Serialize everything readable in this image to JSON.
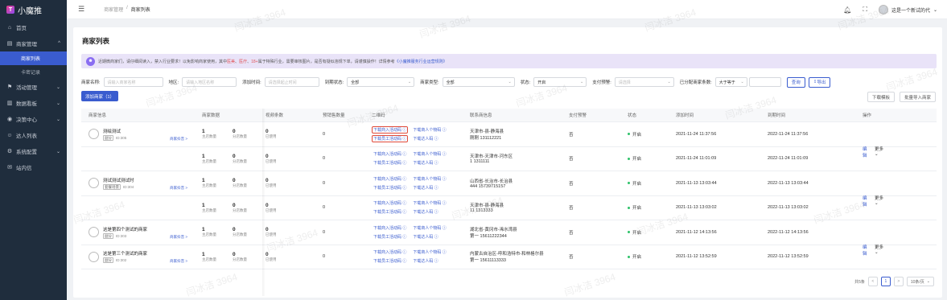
{
  "app": {
    "logo_mark": "T",
    "name": "小魔推"
  },
  "sidebar": {
    "items": [
      {
        "icon": "⌂",
        "label": "首页"
      },
      {
        "icon": "▤",
        "label": "商家管理",
        "chev": "^",
        "open": true
      },
      {
        "icon": "⚑",
        "label": "活动管理",
        "chev": "⌄"
      },
      {
        "icon": "▥",
        "label": "数据看板",
        "chev": "⌄"
      },
      {
        "icon": "◉",
        "label": "决策中心",
        "chev": "⌄"
      },
      {
        "icon": "☺",
        "label": "达人列表"
      },
      {
        "icon": "⚙",
        "label": "系统配置",
        "chev": "⌄"
      },
      {
        "icon": "✉",
        "label": "站内信"
      }
    ],
    "subitems": [
      {
        "label": "商家列表",
        "active": true
      },
      {
        "label": "卡密记录",
        "active": false
      }
    ]
  },
  "header": {
    "breadcrumb": [
      "商家管理",
      "商家列表"
    ],
    "user": "这是一个新试的代",
    "icons": [
      "bell-icon",
      "fullscreen-icon"
    ]
  },
  "page": {
    "title": "商家列表"
  },
  "notice": {
    "pre": "近期微商家们，请仔细阅读入，禁入行业要求！以免影响商家使用，其中",
    "red1": "医美",
    "mid1": "、",
    "red2": "医疗",
    "mid2": "、",
    "red3": "18+",
    "mid3": "属于特殊行业，需要审核图片，是否有疑似违规下单，请谨慎操作！详情参考",
    "link": "《小魔推服务行业运营规则》"
  },
  "filters": {
    "shop_name": {
      "label": "商家名称:",
      "placeholder": "请输入商家名称"
    },
    "region": {
      "label": "地区:",
      "placeholder": "请输入地区名称"
    },
    "add_time": {
      "label": "添加时间:",
      "placeholder": "请选择起止时间"
    },
    "expire_status": {
      "label": "到期状态:",
      "value": "全部"
    },
    "shop_type": {
      "label": "商家类型:",
      "value": "全部"
    },
    "status": {
      "label": "状态:",
      "value": "开启"
    },
    "pay_warn": {
      "label": "支付预警:",
      "placeholder": "请选择"
    },
    "dist_count": {
      "label": "已分配商家条数:",
      "op": "大于等于",
      "value": ""
    },
    "search_label": "查询",
    "export_label": "导出"
  },
  "actions": {
    "add": "添加商家（1）",
    "download_tpl": "下载模板",
    "batch_import": "批量导入商家"
  },
  "table": {
    "headers": [
      "商家信息",
      "商家数据",
      "视频条数",
      "预销售数量",
      "二维码",
      "联系商信息",
      "支付预警",
      "状态",
      "添加时间",
      "到期时间",
      "操作"
    ],
    "data_labels": [
      "主店数量",
      "分店数量"
    ],
    "tpl_label": "已使用",
    "qr_labels": {
      "shop_qr": "下载商入活动码",
      "person_qr": "下载商人个物码",
      "staff_qr": "下载员工活动码",
      "entry_qr": "下载达人码"
    },
    "op_labels": {
      "edit": "编辑",
      "more": "更多"
    },
    "shop_link": "商家抖音",
    "rows": [
      {
        "name": "测绘测试",
        "tag": "副分",
        "id": "ID:305",
        "main": "1",
        "branch": "0",
        "tpl": "0",
        "recv": "0",
        "region": "天津市-县-静海县",
        "phone": "刚刚 131112221",
        "pay": "否",
        "status": "开启",
        "added": "2021-11-24 11:37:56",
        "expire": "2022-11-24 11:37:56"
      },
      {
        "name": "",
        "tag": "",
        "id": "",
        "main": "1",
        "branch": "0",
        "tpl": "0",
        "recv": "0",
        "region": "天津市-天津市-河东区",
        "phone": "1  1311111",
        "pay": "否",
        "status": "开启",
        "added": "2021-11-24 11:01:09",
        "expire": "2022-11-24 11:01:09"
      },
      {
        "name": "测试测试测试时",
        "tag": "套餐场景",
        "id": "ID:304",
        "main": "1",
        "branch": "0",
        "tpl": "0",
        "recv": "0",
        "region": "山西省-长治市-长治县",
        "phone": "444  15739715157",
        "pay": "否",
        "status": "开启",
        "added": "2021-11-13 13:03:44",
        "expire": "2022-11-13 13:03:44"
      },
      {
        "name": "",
        "tag": "",
        "id": "",
        "main": "1",
        "branch": "0",
        "tpl": "0",
        "recv": "0",
        "region": "天津市-县-静海县",
        "phone": "11  1313333",
        "pay": "否",
        "status": "开启",
        "added": "2021-11-13 13:03:02",
        "expire": "2022-11-13 13:03:02"
      },
      {
        "name": "这是第四个测试的商家",
        "tag": "副分",
        "id": "ID:303",
        "main": "1",
        "branch": "0",
        "tpl": "0",
        "recv": "0",
        "region": "湖北省-黄冈市-浠水湾县",
        "phone": "第一  15611222344",
        "pay": "否",
        "status": "开启",
        "added": "2021-11-12 14:13:56",
        "expire": "2022-11-12 14:13:56"
      },
      {
        "name": "这是第三个测试的商家",
        "tag": "副分",
        "id": "ID:302",
        "main": "1",
        "branch": "0",
        "tpl": "0",
        "recv": "0",
        "region": "内蒙古自治区-呼和浩特市-和林格尔县",
        "phone": "第一  15611113333",
        "pay": "否",
        "status": "开启",
        "added": "2021-11-12 13:52:59",
        "expire": "2022-11-12 13:52:59"
      }
    ]
  },
  "pagination": {
    "total": "共5条",
    "prev": "<",
    "page": "1",
    "next": ">",
    "size": "10条/页"
  },
  "watermark": "闫冰洁 3964"
}
